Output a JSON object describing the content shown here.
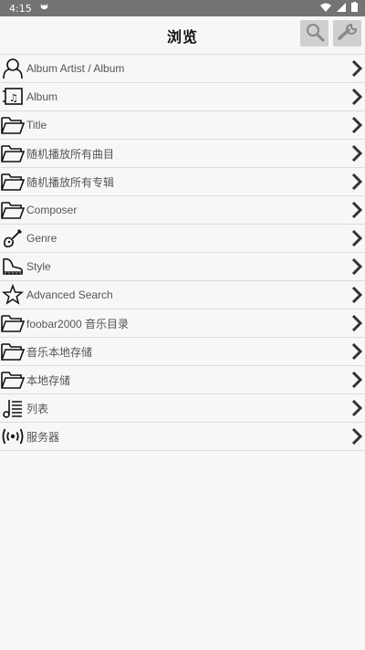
{
  "status": {
    "time": "4:15"
  },
  "header": {
    "title": "浏览"
  },
  "rows": [
    {
      "label": "Album Artist / Album",
      "icon": "person-icon"
    },
    {
      "label": "Album",
      "icon": "album-icon"
    },
    {
      "label": "Title",
      "icon": "folder-icon"
    },
    {
      "label": "随机播放所有曲目",
      "icon": "folder-icon"
    },
    {
      "label": "随机播放所有专辑",
      "icon": "folder-icon"
    },
    {
      "label": "Composer",
      "icon": "folder-icon"
    },
    {
      "label": "Genre",
      "icon": "guitar-icon"
    },
    {
      "label": "Style",
      "icon": "piano-icon"
    },
    {
      "label": "Advanced Search",
      "icon": "star-icon"
    },
    {
      "label": "foobar2000 音乐目录",
      "icon": "folder-icon"
    },
    {
      "label": "音乐本地存储",
      "icon": "folder-icon"
    },
    {
      "label": "本地存储",
      "icon": "folder-icon"
    },
    {
      "label": "列表",
      "icon": "playlist-icon"
    },
    {
      "label": "服务器",
      "icon": "broadcast-icon"
    }
  ]
}
